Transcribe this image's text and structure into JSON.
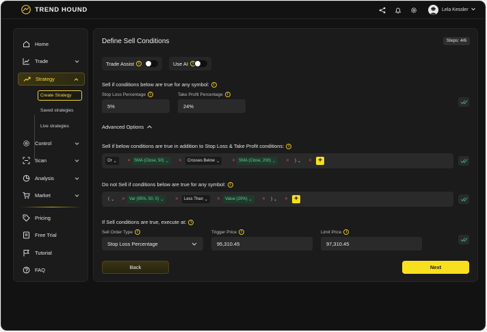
{
  "app": {
    "name": "TREND HOUND"
  },
  "header": {
    "user_name": "Lela Kessler"
  },
  "sidebar": {
    "items": [
      {
        "label": "Home",
        "icon": "home-icon"
      },
      {
        "label": "Trade",
        "icon": "chart-line-icon"
      },
      {
        "label": "Strategy",
        "icon": "trend-up-icon"
      },
      {
        "label": "Control",
        "icon": "settings-icon"
      },
      {
        "label": "Scan",
        "icon": "scan-icon"
      },
      {
        "label": "Analysis",
        "icon": "analysis-icon"
      },
      {
        "label": "Market",
        "icon": "cart-icon"
      },
      {
        "label": "Pricing",
        "icon": "tag-icon"
      },
      {
        "label": "Free Trial",
        "icon": "document-icon"
      },
      {
        "label": "Tutorial",
        "icon": "flag-icon"
      },
      {
        "label": "FAQ",
        "icon": "help-icon"
      }
    ],
    "strategy_sub": [
      "Create Strategy",
      "Saved strategies",
      "Live strategies"
    ]
  },
  "main": {
    "title": "Define Sell Conditions",
    "steps": "Steps: 4/6",
    "toggles": {
      "trade_assist": "Trade Assist",
      "use_ai": "Use AI"
    },
    "section1": {
      "heading": "Sell if conditions below are true for any symbol:",
      "stop_loss_label": "Stop Loss Percentage",
      "stop_loss_value": "5%",
      "take_profit_label": "Take Profit Percentage",
      "take_profit_value": "24%"
    },
    "advanced_options": "Advanced Options",
    "section2": {
      "heading": "Sell if below conditions are true in addition to Stop Loss & Take Profit conditions:",
      "chips": [
        "Or",
        "SMA (Close, 50)",
        "Crosses Below",
        "SMA (Close, 200)",
        ")"
      ]
    },
    "section3": {
      "heading": "Do not Sell if conditions below are true for any symbol:",
      "chips": [
        "(",
        "Var (95%, 50, 0)",
        "Less Than",
        "Value (20%)",
        ")"
      ]
    },
    "section4": {
      "heading": "If Sell conditions are true, execute at:",
      "order_type_label": "Sell Order Type",
      "order_type_value": "Stop Loss Percentage",
      "trigger_label": "Trigger Price",
      "trigger_value": "95,310.45",
      "limit_label": "Limit Price",
      "limit_value": "97,310.45"
    },
    "back_label": "Back",
    "next_label": "Next"
  },
  "colors": {
    "accent": "#f8e01f",
    "background": "#121212",
    "panel": "#1b1b1b",
    "green_chip": "#5fd38c",
    "remove_x": "#d84949"
  }
}
